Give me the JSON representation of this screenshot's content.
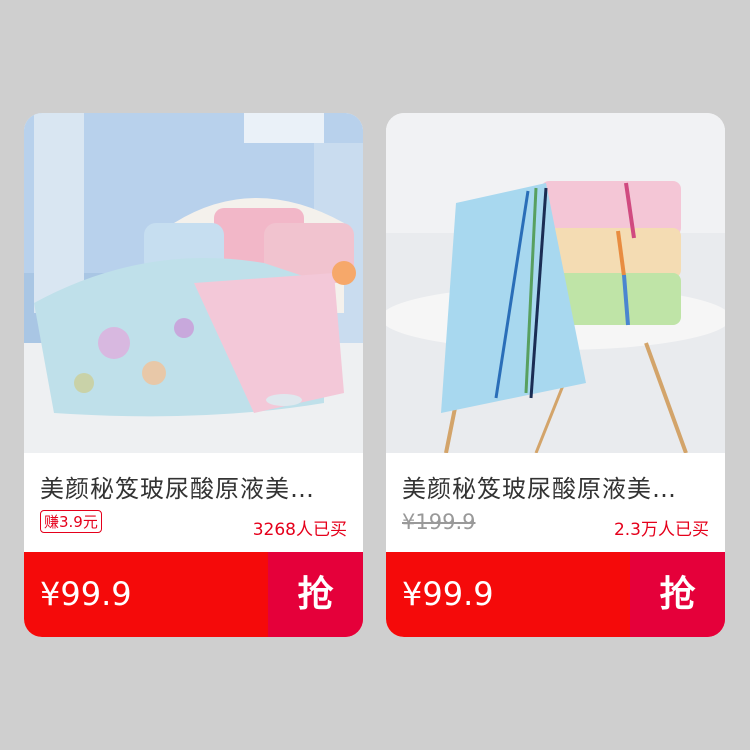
{
  "products": [
    {
      "image_name": "bedding-set-photo",
      "title": "美颜秘笈玻尿酸原液美…",
      "badge": "赚3.9元",
      "sold": "3268人已买",
      "price": "¥99.9",
      "buy_label": "抢"
    },
    {
      "image_name": "towels-photo",
      "title": "美颜秘笈玻尿酸原液美…",
      "old_price": "¥199.9",
      "sold": "2.3万人已买",
      "price": "¥99.9",
      "buy_label": "抢"
    }
  ],
  "colors": {
    "accent_red": "#f50a0a",
    "grab_red": "#e5003a",
    "card_bg": "#ffffff",
    "page_bg": "#cfcfcf"
  }
}
